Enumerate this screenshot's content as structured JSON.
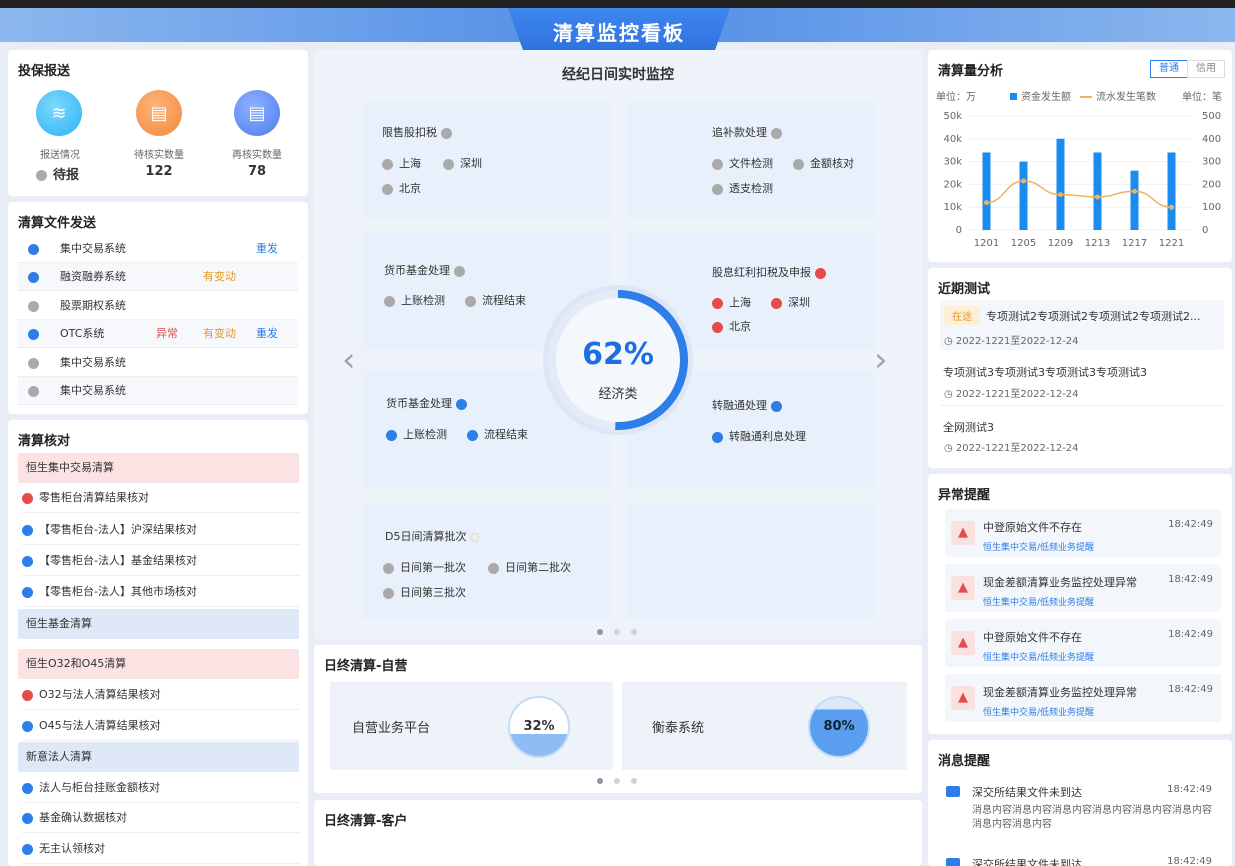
{
  "title": "清算监控看板",
  "tb": {
    "title": "投保报送",
    "items": [
      {
        "label": "报送情况",
        "value": "待报",
        "color": "#2ab3f2"
      },
      {
        "label": "待核实数量",
        "value": "122",
        "color": "#f08a3a"
      },
      {
        "label": "再核实数量",
        "value": "78",
        "color": "#4b7ef0"
      }
    ]
  },
  "qwf": {
    "title": "清算文件发送",
    "rows": [
      {
        "name": "集中交易系统",
        "status": "",
        "tag": "",
        "action": "重发",
        "state": "blue"
      },
      {
        "name": "融资融券系统",
        "status": "",
        "tag": "有变动",
        "action": "",
        "state": "blue"
      },
      {
        "name": "股票期权系统",
        "status": "",
        "tag": "",
        "action": "",
        "state": "gray"
      },
      {
        "name": "OTC系统",
        "status": "异常",
        "tag": "有变动",
        "action": "重发",
        "state": "blue"
      },
      {
        "name": "集中交易系统",
        "status": "",
        "tag": "",
        "action": "",
        "state": "gray"
      },
      {
        "name": "集中交易系统",
        "status": "",
        "tag": "",
        "action": "",
        "state": "gray"
      }
    ]
  },
  "qsh": {
    "title": "清算核对",
    "g1": "恒生集中交易清算",
    "g1items": [
      "零售柜台清算结果核对",
      "【零售柜台-法人】沪深结果核对",
      "【零售柜台-法人】基金结果核对",
      "【零售柜台-法人】其他市场核对"
    ],
    "g2": "恒生基金清算",
    "g3": "恒生O32和O45清算",
    "g3items": [
      "O32与法人清算结果核对",
      "O45与法人清算结果核对"
    ],
    "g4": "新意法人清算",
    "g4items": [
      "法人与柜台挂账金额核对",
      "基金确认数据核对",
      "无主认领核对"
    ]
  },
  "rt": {
    "title": "经纪日间实时监控",
    "percent": "62%",
    "label": "经济类",
    "p1": {
      "title": "限售股扣税",
      "a": "上海",
      "b": "深圳",
      "c": "北京"
    },
    "p2": {
      "title": "追补款处理",
      "a": "文件检测",
      "b": "金额核对",
      "c": "透支检测"
    },
    "p3": {
      "title": "货币基金处理",
      "a": "上账检测",
      "b": "流程结束"
    },
    "p4": {
      "title": "股息红利扣税及申报",
      "a": "上海",
      "b": "深圳",
      "c": "北京"
    },
    "p5": {
      "title": "货币基金处理",
      "a": "上账检测",
      "b": "流程结束"
    },
    "p6": {
      "title": "转融通处理",
      "a": "转融通利息处理"
    },
    "p7": {
      "title": "D5日间清算批次",
      "a": "日间第一批次",
      "b": "日间第二批次",
      "c": "日间第三批次"
    }
  },
  "ry": {
    "title": "日终清算-自营",
    "a": "自营业务平台",
    "ap": "32%",
    "b": "衡泰系统",
    "bp": "80%"
  },
  "rk": {
    "title": "日终清算-客户"
  },
  "qsl": {
    "title": "清算量分析",
    "tab1": "普通",
    "tab2": "信用",
    "unitl": "单位：万",
    "unitr": "单位：笔",
    "leg1": "资金发生额",
    "leg2": "流水发生笔数"
  },
  "chart_data": {
    "type": "bar",
    "categories": [
      "1201",
      "1205",
      "1209",
      "1213",
      "1217",
      "1221"
    ],
    "series": [
      {
        "name": "资金发生额",
        "values": [
          34000,
          30000,
          40000,
          34000,
          26000,
          34000
        ]
      },
      {
        "name": "流水发生笔数",
        "values": [
          120,
          215,
          155,
          145,
          170,
          100
        ]
      }
    ],
    "yticks_left": [
      "50k",
      "40k",
      "30k",
      "20k",
      "10k",
      "0"
    ],
    "yticks_right": [
      "500",
      "400",
      "300",
      "200",
      "100",
      "0"
    ],
    "ylim": [
      0,
      50000
    ],
    "y2lim": [
      0,
      500
    ]
  },
  "jq": {
    "title": "近期测试",
    "items": [
      {
        "tag": "在途",
        "name": "专项测试2专项测试2专项测试2专项测试2...",
        "date": "2022-1221至2022-12-24"
      },
      {
        "tag": "",
        "name": "专项测试3专项测试3专项测试3专项测试3",
        "date": "2022-1221至2022-12-24"
      },
      {
        "tag": "",
        "name": "全网测试3",
        "date": "2022-1221至2022-12-24"
      }
    ]
  },
  "yc": {
    "title": "异常提醒",
    "items": [
      {
        "t": "中登原始文件不存在",
        "s": "恒生集中交易/低频业务提醒",
        "time": "18:42:49"
      },
      {
        "t": "现金差额清算业务监控处理异常",
        "s": "恒生集中交易/低频业务提醒",
        "time": "18:42:49"
      },
      {
        "t": "中登原始文件不存在",
        "s": "恒生集中交易/低频业务提醒",
        "time": "18:42:49"
      },
      {
        "t": "现金差额清算业务监控处理异常",
        "s": "恒生集中交易/低频业务提醒",
        "time": "18:42:49"
      }
    ]
  },
  "xx": {
    "title": "消息提醒",
    "items": [
      {
        "t": "深交所结果文件未到达",
        "time": "18:42:49",
        "body": "消息内容消息内容消息内容消息内容消息内容消息内容消息内容消息内容"
      },
      {
        "t": "深交所结果文件未到达",
        "time": "18:42:49"
      }
    ]
  }
}
